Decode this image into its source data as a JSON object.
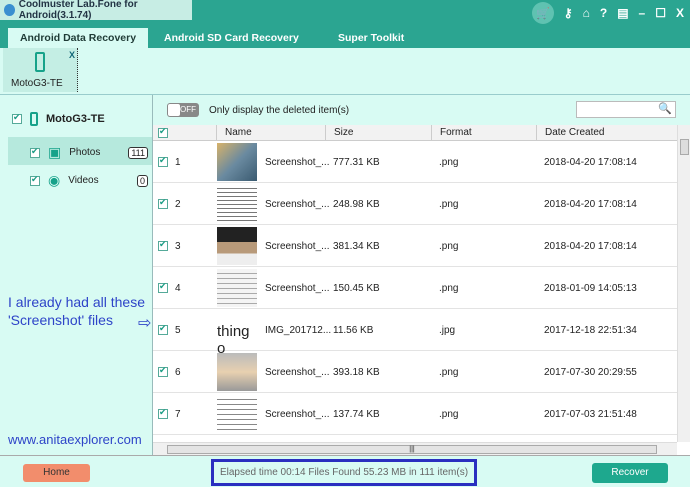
{
  "app": {
    "title": "Coolmuster Lab.Fone for Android(3.1.74)"
  },
  "titlebar_icons": [
    "cart-icon",
    "key-icon",
    "home-icon",
    "help-icon",
    "register-icon",
    "minimize-icon",
    "maximize-icon",
    "close-icon"
  ],
  "tabs": [
    {
      "label": "Android Data Recovery",
      "active": true
    },
    {
      "label": "Android SD Card Recovery"
    },
    {
      "label": "Super Toolkit"
    }
  ],
  "device_tab": {
    "name": "MotoG3-TE",
    "close": "X"
  },
  "sidebar": {
    "device": "MotoG3-TE",
    "items": [
      {
        "label": "Photos",
        "count": "111",
        "selected": true
      },
      {
        "label": "Videos",
        "count": "0"
      }
    ]
  },
  "filter": {
    "toggle": "OFF",
    "label": "Only display the deleted item(s)",
    "search_placeholder": ""
  },
  "table": {
    "columns": [
      "Name",
      "Size",
      "Format",
      "Date Created"
    ],
    "rows": [
      {
        "n": "1",
        "name": "Screenshot_...",
        "size": "777.31 KB",
        "format": ".png",
        "date": "2018-04-20 17:08:14"
      },
      {
        "n": "2",
        "name": "Screenshot_...",
        "size": "248.98 KB",
        "format": ".png",
        "date": "2018-04-20 17:08:14"
      },
      {
        "n": "3",
        "name": "Screenshot_...",
        "size": "381.34 KB",
        "format": ".png",
        "date": "2018-04-20 17:08:14"
      },
      {
        "n": "4",
        "name": "Screenshot_...",
        "size": "150.45 KB",
        "format": ".png",
        "date": "2018-01-09 14:05:13"
      },
      {
        "n": "5",
        "name": "IMG_201712...",
        "size": "11.56 KB",
        "format": ".jpg",
        "date": "2017-12-18 22:51:34",
        "thumb_text": "thing o"
      },
      {
        "n": "6",
        "name": "Screenshot_...",
        "size": "393.18 KB",
        "format": ".png",
        "date": "2017-07-30 20:29:55"
      },
      {
        "n": "7",
        "name": "Screenshot_...",
        "size": "137.74 KB",
        "format": ".png",
        "date": "2017-07-03 21:51:48"
      }
    ]
  },
  "footer": {
    "home": "Home",
    "status": "Elapsed time 00:14  Files Found 55.23 MB in 111 item(s)",
    "recover": "Recover"
  },
  "annotation": {
    "text": "I already had all these 'Screenshot' files",
    "watermark": "www.anitaexplorer.com"
  },
  "colors": {
    "teal": "#2ba591",
    "mint": "#d8fbf3",
    "home": "#f28d6c",
    "recover": "#1ea88e",
    "highlight": "#2a2fc0",
    "annotation": "#2e44c8"
  }
}
